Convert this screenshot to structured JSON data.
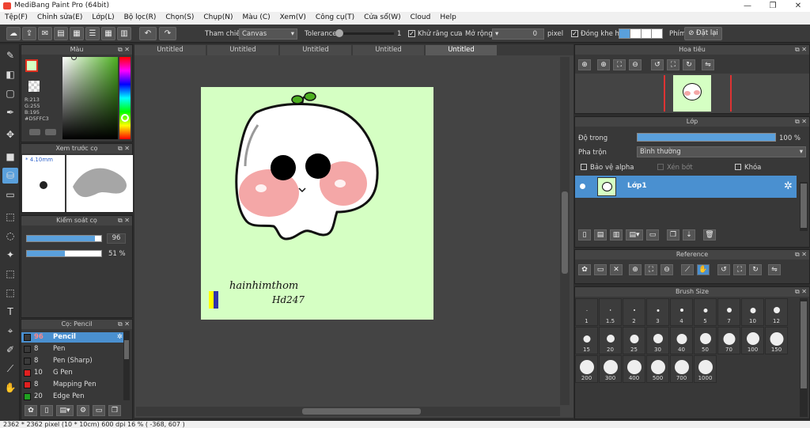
{
  "window": {
    "title": "MediBang Paint Pro (64bit)"
  },
  "menu": [
    "Tệp(F)",
    "Chỉnh sửa(E)",
    "Lớp(L)",
    "Bộ lọc(R)",
    "Chọn(S)",
    "Chụp(N)",
    "Màu (C)",
    "Xem(V)",
    "Công cụ(T)",
    "Cửa sổ(W)",
    "Cloud",
    "Help"
  ],
  "toolbar": {
    "ref_label": "Tham chiếu",
    "ref_value": "Canvas",
    "tolerance_label": "Tolerance",
    "tolerance_value": "1",
    "antialias_label": "Khử răng cưa",
    "expand_label": "Mở rộng",
    "expand_value": "0",
    "expand_unit": "pixel",
    "close_gap_label": "Đóng khe hở",
    "key_label": "Phím",
    "reset_label": "Đặt lại"
  },
  "tabs": [
    "Untitled",
    "Untitled",
    "Untitled",
    "Untitled",
    "Untitled"
  ],
  "color_panel": {
    "title": "Màu",
    "r": "R:213",
    "g": "G:255",
    "b": "B:195",
    "hex": "#D5FFC3",
    "primary": "#d5ffc3"
  },
  "preview_panel": {
    "title": "Xem trước cọ",
    "size": "4.10mm"
  },
  "brush_control": {
    "title": "Kiểm soát cọ",
    "size": "96",
    "opacity": "51 %",
    "size_fraction": 0.92,
    "opacity_fraction": 0.51
  },
  "brush_list": {
    "title": "Cọ: Pencil",
    "items": [
      {
        "size": "96",
        "name": "Pencil",
        "color": "#3a3a3a"
      },
      {
        "size": "8",
        "name": "Pen",
        "color": "#3a3a3a"
      },
      {
        "size": "8",
        "name": "Pen (Sharp)",
        "color": "#3a3a3a"
      },
      {
        "size": "10",
        "name": "G Pen",
        "color": "#e02020"
      },
      {
        "size": "8",
        "name": "Mapping Pen",
        "color": "#e02020"
      },
      {
        "size": "20",
        "name": "Edge Pen",
        "color": "#20a020"
      }
    ]
  },
  "navigator": {
    "title": "Hoa tiêu"
  },
  "layer_panel": {
    "title": "Lớp",
    "opacity_label": "Độ trong",
    "opacity_value": "100 %",
    "opacity_fraction": 1.0,
    "blend_label": "Pha trộn",
    "blend_value": "Bình thường",
    "protect_alpha": "Bảo vệ alpha",
    "clipping": "Xén bớt",
    "lock": "Khóa",
    "layer_name": "Lớp1"
  },
  "reference_panel": {
    "title": "Reference"
  },
  "brush_size_panel": {
    "title": "Brush Size",
    "sizes": [
      "1",
      "1.5",
      "2",
      "3",
      "4",
      "5",
      "7",
      "10",
      "12",
      "15",
      "20",
      "25",
      "30",
      "40",
      "50",
      "70",
      "100",
      "150",
      "200",
      "300",
      "400",
      "500",
      "700",
      "1000"
    ]
  },
  "artwork": {
    "signature_line1": "hainhimthom",
    "signature_line2": "Hd247",
    "bg": "#d5ffc3"
  },
  "status": "2362 * 2362 pixel   (10 * 10cm)   600 dpi   16 %   ( -368, 607 )"
}
